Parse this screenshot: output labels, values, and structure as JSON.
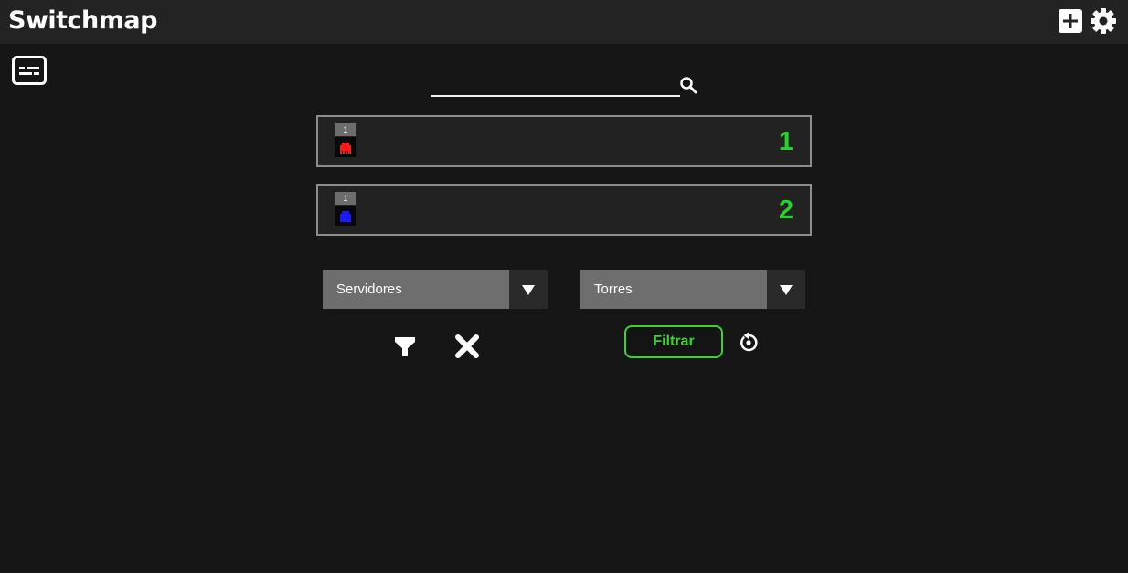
{
  "app": {
    "title": "Switchmap"
  },
  "header": {
    "add_icon": "add-box-icon",
    "settings_icon": "gear-icon"
  },
  "toolbar": {
    "subtitles_icon": "subtitles-icon"
  },
  "search": {
    "value": "",
    "placeholder": "",
    "icon": "search-icon"
  },
  "switches": [
    {
      "port_label": "1",
      "number": "1",
      "port_color": "#ff1a1a"
    },
    {
      "port_label": "1",
      "number": "2",
      "port_color": "#1a1aff"
    }
  ],
  "filters": {
    "servers_select": {
      "value": "Servidores"
    },
    "towers_select": {
      "value": "Torres"
    },
    "filter_icon": "funnel-icon",
    "clear_icon": "close-icon",
    "filter_button_label": "Filtrar",
    "reset_icon": "reset-icon"
  },
  "colors": {
    "accent_green": "#3fd12f",
    "number_green": "#27d22b",
    "background": "#161616",
    "header_background": "#232323"
  }
}
